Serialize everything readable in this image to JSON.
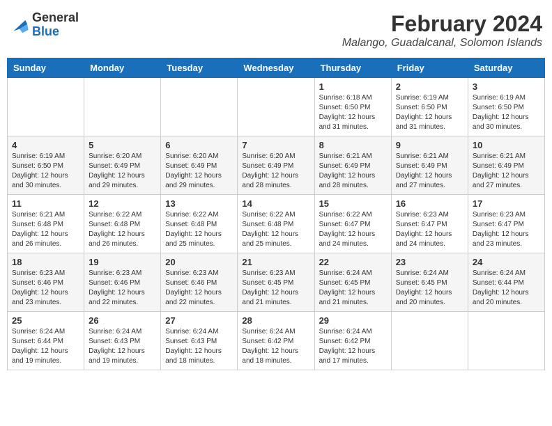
{
  "header": {
    "logo_general": "General",
    "logo_blue": "Blue",
    "title": "February 2024",
    "subtitle": "Malango, Guadalcanal, Solomon Islands"
  },
  "days_of_week": [
    "Sunday",
    "Monday",
    "Tuesday",
    "Wednesday",
    "Thursday",
    "Friday",
    "Saturday"
  ],
  "weeks": [
    [
      {
        "day": "",
        "info": ""
      },
      {
        "day": "",
        "info": ""
      },
      {
        "day": "",
        "info": ""
      },
      {
        "day": "",
        "info": ""
      },
      {
        "day": "1",
        "info": "Sunrise: 6:18 AM\nSunset: 6:50 PM\nDaylight: 12 hours and 31 minutes."
      },
      {
        "day": "2",
        "info": "Sunrise: 6:19 AM\nSunset: 6:50 PM\nDaylight: 12 hours and 31 minutes."
      },
      {
        "day": "3",
        "info": "Sunrise: 6:19 AM\nSunset: 6:50 PM\nDaylight: 12 hours and 30 minutes."
      }
    ],
    [
      {
        "day": "4",
        "info": "Sunrise: 6:19 AM\nSunset: 6:50 PM\nDaylight: 12 hours and 30 minutes."
      },
      {
        "day": "5",
        "info": "Sunrise: 6:20 AM\nSunset: 6:49 PM\nDaylight: 12 hours and 29 minutes."
      },
      {
        "day": "6",
        "info": "Sunrise: 6:20 AM\nSunset: 6:49 PM\nDaylight: 12 hours and 29 minutes."
      },
      {
        "day": "7",
        "info": "Sunrise: 6:20 AM\nSunset: 6:49 PM\nDaylight: 12 hours and 28 minutes."
      },
      {
        "day": "8",
        "info": "Sunrise: 6:21 AM\nSunset: 6:49 PM\nDaylight: 12 hours and 28 minutes."
      },
      {
        "day": "9",
        "info": "Sunrise: 6:21 AM\nSunset: 6:49 PM\nDaylight: 12 hours and 27 minutes."
      },
      {
        "day": "10",
        "info": "Sunrise: 6:21 AM\nSunset: 6:49 PM\nDaylight: 12 hours and 27 minutes."
      }
    ],
    [
      {
        "day": "11",
        "info": "Sunrise: 6:21 AM\nSunset: 6:48 PM\nDaylight: 12 hours and 26 minutes."
      },
      {
        "day": "12",
        "info": "Sunrise: 6:22 AM\nSunset: 6:48 PM\nDaylight: 12 hours and 26 minutes."
      },
      {
        "day": "13",
        "info": "Sunrise: 6:22 AM\nSunset: 6:48 PM\nDaylight: 12 hours and 25 minutes."
      },
      {
        "day": "14",
        "info": "Sunrise: 6:22 AM\nSunset: 6:48 PM\nDaylight: 12 hours and 25 minutes."
      },
      {
        "day": "15",
        "info": "Sunrise: 6:22 AM\nSunset: 6:47 PM\nDaylight: 12 hours and 24 minutes."
      },
      {
        "day": "16",
        "info": "Sunrise: 6:23 AM\nSunset: 6:47 PM\nDaylight: 12 hours and 24 minutes."
      },
      {
        "day": "17",
        "info": "Sunrise: 6:23 AM\nSunset: 6:47 PM\nDaylight: 12 hours and 23 minutes."
      }
    ],
    [
      {
        "day": "18",
        "info": "Sunrise: 6:23 AM\nSunset: 6:46 PM\nDaylight: 12 hours and 23 minutes."
      },
      {
        "day": "19",
        "info": "Sunrise: 6:23 AM\nSunset: 6:46 PM\nDaylight: 12 hours and 22 minutes."
      },
      {
        "day": "20",
        "info": "Sunrise: 6:23 AM\nSunset: 6:46 PM\nDaylight: 12 hours and 22 minutes."
      },
      {
        "day": "21",
        "info": "Sunrise: 6:23 AM\nSunset: 6:45 PM\nDaylight: 12 hours and 21 minutes."
      },
      {
        "day": "22",
        "info": "Sunrise: 6:24 AM\nSunset: 6:45 PM\nDaylight: 12 hours and 21 minutes."
      },
      {
        "day": "23",
        "info": "Sunrise: 6:24 AM\nSunset: 6:45 PM\nDaylight: 12 hours and 20 minutes."
      },
      {
        "day": "24",
        "info": "Sunrise: 6:24 AM\nSunset: 6:44 PM\nDaylight: 12 hours and 20 minutes."
      }
    ],
    [
      {
        "day": "25",
        "info": "Sunrise: 6:24 AM\nSunset: 6:44 PM\nDaylight: 12 hours and 19 minutes."
      },
      {
        "day": "26",
        "info": "Sunrise: 6:24 AM\nSunset: 6:43 PM\nDaylight: 12 hours and 19 minutes."
      },
      {
        "day": "27",
        "info": "Sunrise: 6:24 AM\nSunset: 6:43 PM\nDaylight: 12 hours and 18 minutes."
      },
      {
        "day": "28",
        "info": "Sunrise: 6:24 AM\nSunset: 6:42 PM\nDaylight: 12 hours and 18 minutes."
      },
      {
        "day": "29",
        "info": "Sunrise: 6:24 AM\nSunset: 6:42 PM\nDaylight: 12 hours and 17 minutes."
      },
      {
        "day": "",
        "info": ""
      },
      {
        "day": "",
        "info": ""
      }
    ]
  ]
}
